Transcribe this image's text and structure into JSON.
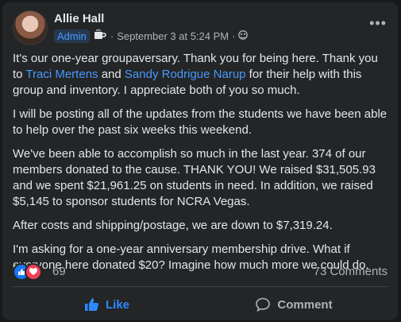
{
  "post": {
    "author": "Allie Hall",
    "role_badge": "Admin",
    "timestamp": "September 3 at 5:24 PM",
    "separator": "·",
    "more_label": "•••",
    "paragraphs": [
      {
        "pre": "It's our one-year groupaversary. Thank you for being here. Thank you to ",
        "link1": "Traci Mertens",
        "mid": " and ",
        "link2": "Sandy Rodrigue Narup",
        "post": " for their help with this group and inventory. I appreciate both of you so much."
      },
      "I will be posting all of the updates from the students we have been able to help over the past six weeks this weekend.",
      "We've been able to accomplish so much in the last year. 374 of our members donated to the cause. THANK YOU! We raised $31,505.93 and we spent $21,961.25 on students in need. In addition, we raised $5,145 to sponsor students for NCRA Vegas.",
      "After costs and shipping/postage, we are down to $7,319.24.",
      "I'm asking for a one-year anniversary membership drive. What if everyone here donated $20? Imagine how much more we could do."
    ],
    "reaction_count": "69",
    "comments_count": "73 Comments"
  },
  "actions": {
    "like_label": "Like",
    "comment_label": "Comment"
  },
  "colors": {
    "accent": "#2d88ff",
    "link": "#4599ff",
    "card_bg": "#242526",
    "text": "#e4e6eb",
    "secondary": "#b0b3b8"
  }
}
